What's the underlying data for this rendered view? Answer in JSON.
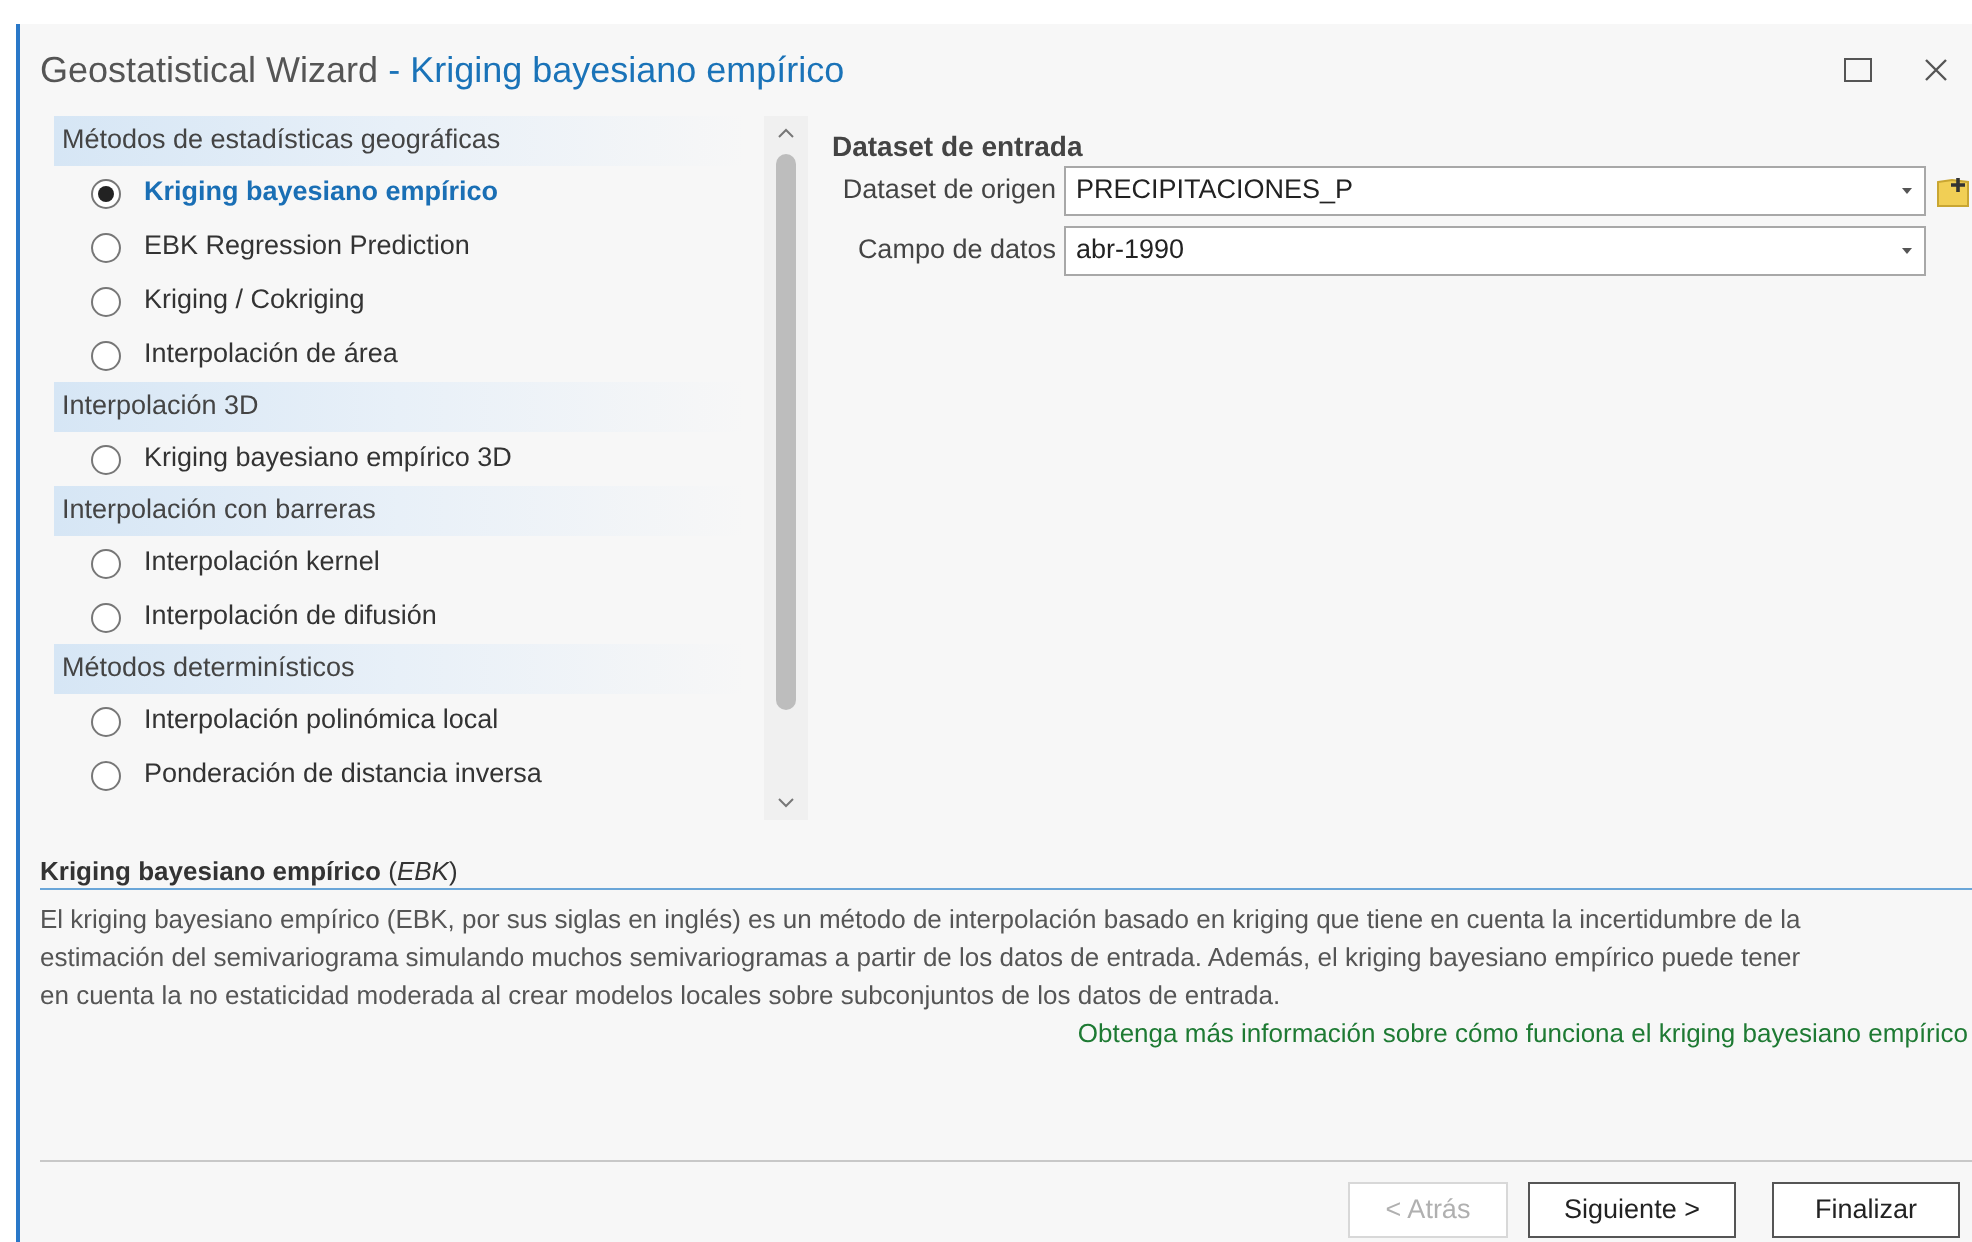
{
  "window": {
    "title": "Geostatistical Wizard",
    "subtitle": "- Kriging bayesiano empírico"
  },
  "methods": [
    {
      "heading": "Métodos de estadísticas geográficas",
      "items": [
        {
          "label": "Kriging bayesiano empírico",
          "selected": true
        },
        {
          "label": "EBK Regression Prediction",
          "selected": false
        },
        {
          "label": "Kriging / Cokriging",
          "selected": false
        },
        {
          "label": "Interpolación de área",
          "selected": false
        }
      ]
    },
    {
      "heading": "Interpolación 3D",
      "items": [
        {
          "label": "Kriging bayesiano empírico 3D",
          "selected": false
        }
      ]
    },
    {
      "heading": "Interpolación con barreras",
      "items": [
        {
          "label": "Interpolación kernel",
          "selected": false
        },
        {
          "label": "Interpolación de difusión",
          "selected": false
        }
      ]
    },
    {
      "heading": "Métodos determinísticos",
      "items": [
        {
          "label": "Interpolación polinómica local",
          "selected": false
        },
        {
          "label": "Ponderación de distancia inversa",
          "selected": false
        }
      ]
    }
  ],
  "input": {
    "heading": "Dataset de entrada",
    "fields": [
      {
        "label": "Dataset de origen",
        "value": "PRECIPITACIONES_P",
        "add_button": true
      },
      {
        "label": "Campo de datos",
        "value": "abr-1990",
        "add_button": false
      }
    ]
  },
  "description": {
    "title": "**Kriging bayesiano empírico** (*EBK*)",
    "text": "El kriging bayesiano empírico (EBK, por sus siglas en inglés) es un método de interpolación basado en kriging que tiene en cuenta la incertidumbre de la estimación del semivariograma simulando muchos semivariogramas a partir de los datos de entrada. Además, el kriging bayesiano empírico puede tener en cuenta la no estaticidad moderada al crear modelos locales sobre subconjuntos de los datos de entrada.",
    "link": "Obtenga más información sobre cómo funciona el kriging bayesiano empírico"
  },
  "buttons": [
    {
      "label": "< Atrás",
      "disabled": true
    },
    {
      "label": "Siguiente >",
      "disabled": false
    },
    {
      "label": "Finalizar",
      "disabled": false
    }
  ]
}
